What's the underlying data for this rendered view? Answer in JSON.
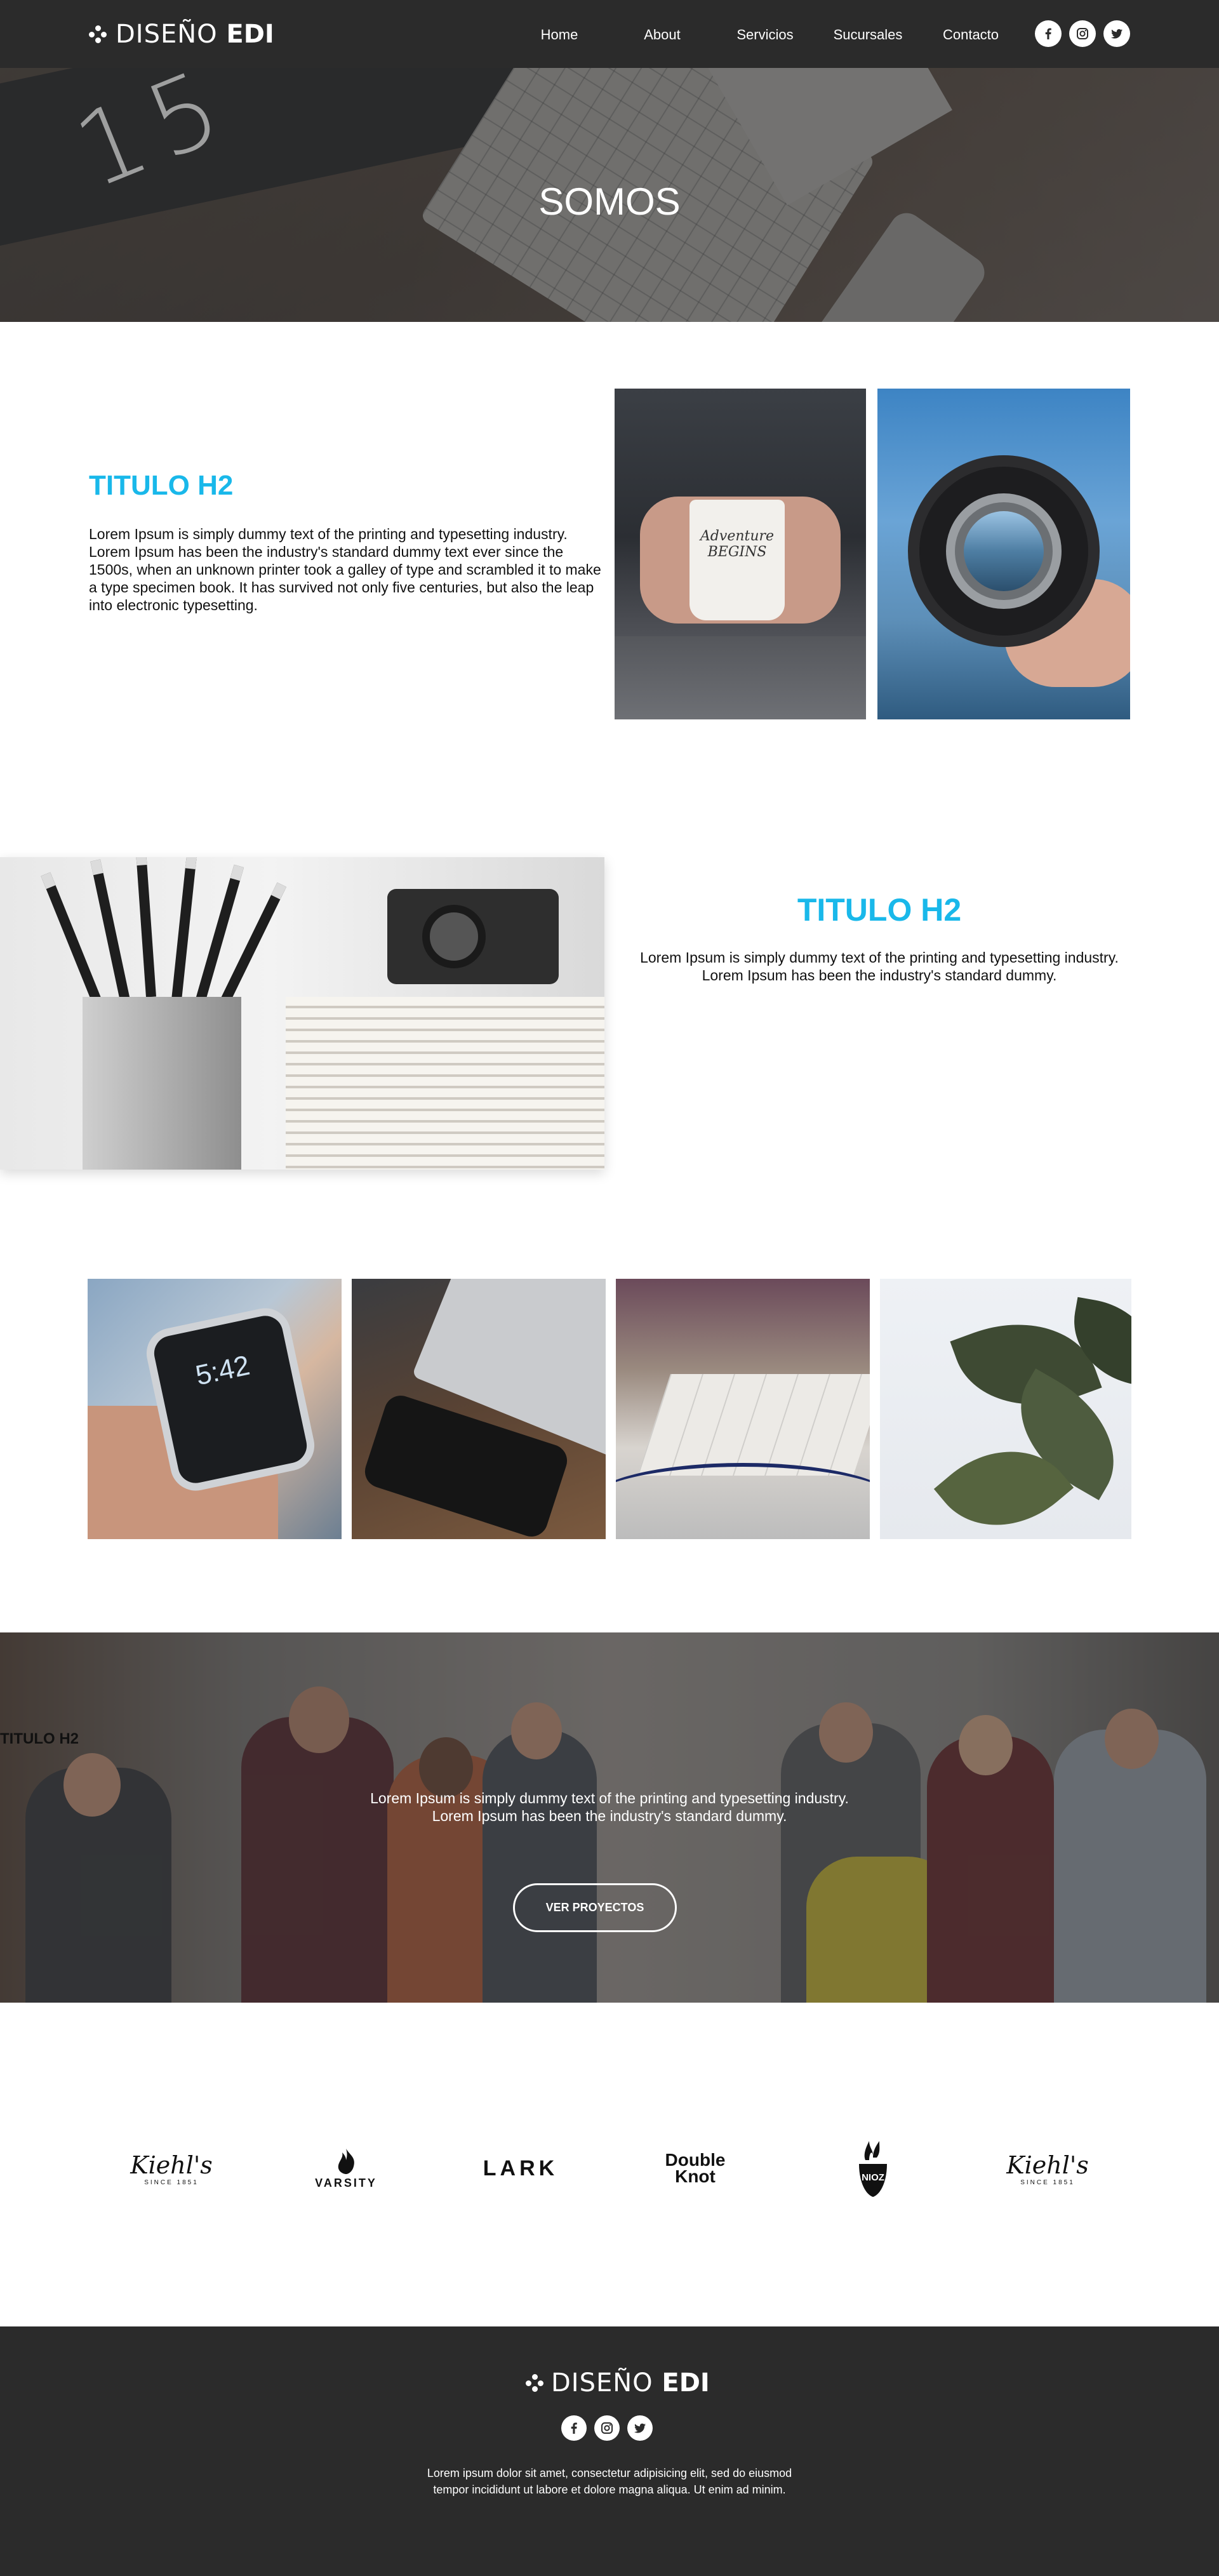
{
  "nav": {
    "logo": {
      "light": "DISEÑO ",
      "bold": "EDI"
    },
    "menu": [
      "Home",
      "About",
      "Servicios",
      "Sucursales",
      "Contacto"
    ],
    "socials": [
      "facebook-icon",
      "instagram-icon",
      "twitter-icon"
    ]
  },
  "hero": {
    "title": "SOMOS",
    "background_number": "15"
  },
  "section1": {
    "title": "TITULO H2",
    "text": "Lorem Ipsum is simply dummy text of the printing and typesetting industry. Lorem Ipsum has been the industry's standard dummy text ever since the 1500s, when an unknown printer took a galley of type and scrambled it to make a type specimen book. It has survived not only five centuries, but also the leap into electronic typesetting.",
    "mug_text": "Adventure BEGINS"
  },
  "section2": {
    "title": "TITULO H2",
    "text_line1": "Lorem Ipsum is simply dummy text of the printing and typesetting industry.",
    "text_line2": "Lorem Ipsum has been the industry's standard dummy."
  },
  "gallery": {
    "watch_time": "5:42"
  },
  "team": {
    "title": "TITULO H2",
    "text_line1": "Lorem Ipsum is simply dummy text of the printing and typesetting industry.",
    "text_line2": "Lorem Ipsum has been the industry's standard dummy.",
    "cta": "VER PROYECTOS"
  },
  "brands": [
    {
      "name": "Kiehl's",
      "sub": "SINCE 1851"
    },
    {
      "name": "VARSITY",
      "sub": ""
    },
    {
      "name": "LARK",
      "sub": ""
    },
    {
      "name": "Double Knot",
      "sub": ""
    },
    {
      "name": "NIOZ",
      "sub": ""
    },
    {
      "name": "Kiehl's",
      "sub": "SINCE 1851"
    }
  ],
  "footer": {
    "logo": {
      "light": "DISEÑO ",
      "bold": "EDI"
    },
    "socials": [
      "facebook-icon",
      "instagram-icon",
      "twitter-icon"
    ],
    "text": "Lorem ipsum dolor sit amet, consectetur adipisicing elit, sed do eiusmod tempor incididunt ut labore et dolore magna aliqua. Ut enim ad minim."
  },
  "colors": {
    "accent": "#19b8ea",
    "dark": "#2b2b2b"
  }
}
